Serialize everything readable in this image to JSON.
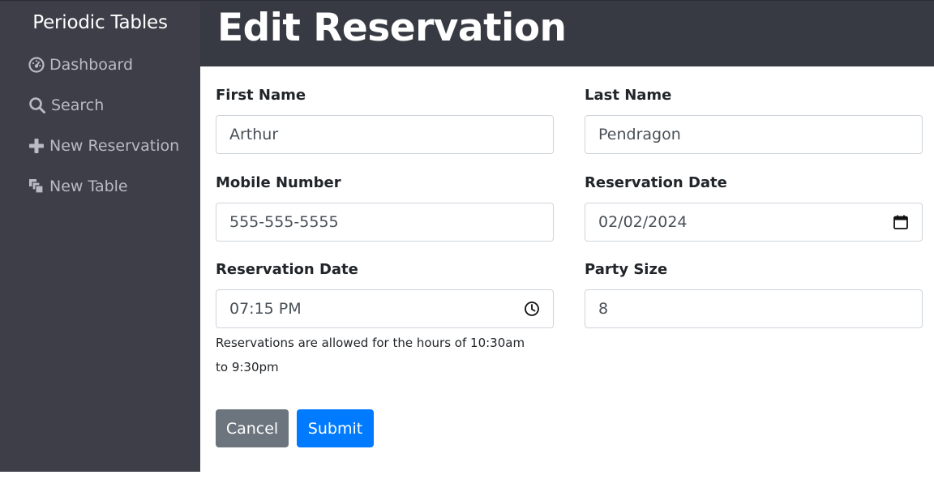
{
  "sidebar": {
    "brand": "Periodic Tables",
    "items": [
      {
        "label": "Dashboard",
        "icon": "dashboard-icon"
      },
      {
        "label": "Search",
        "icon": "search-icon"
      },
      {
        "label": "New Reservation",
        "icon": "plus-icon"
      },
      {
        "label": "New Table",
        "icon": "layers-icon"
      }
    ]
  },
  "header": {
    "title": "Edit Reservation"
  },
  "form": {
    "first_name": {
      "label": "First Name",
      "value": "Arthur"
    },
    "last_name": {
      "label": "Last Name",
      "value": "Pendragon"
    },
    "mobile_number": {
      "label": "Mobile Number",
      "value": "555-555-5555"
    },
    "reservation_date": {
      "label": "Reservation Date",
      "value": "02/02/2024",
      "icon": "calendar-icon"
    },
    "reservation_time": {
      "label": "Reservation Date",
      "value": "07:15 PM",
      "icon": "clock-icon"
    },
    "party_size": {
      "label": "Party Size",
      "value": "8"
    },
    "time_help": "Reservations are allowed for the hours of 10:30am to 9:30pm"
  },
  "buttons": {
    "cancel": "Cancel",
    "submit": "Submit"
  },
  "colors": {
    "sidebar_bg": "#3d3e48",
    "header_bg": "#373a42",
    "cancel_bg": "#6c757d",
    "submit_bg": "#007bff"
  }
}
